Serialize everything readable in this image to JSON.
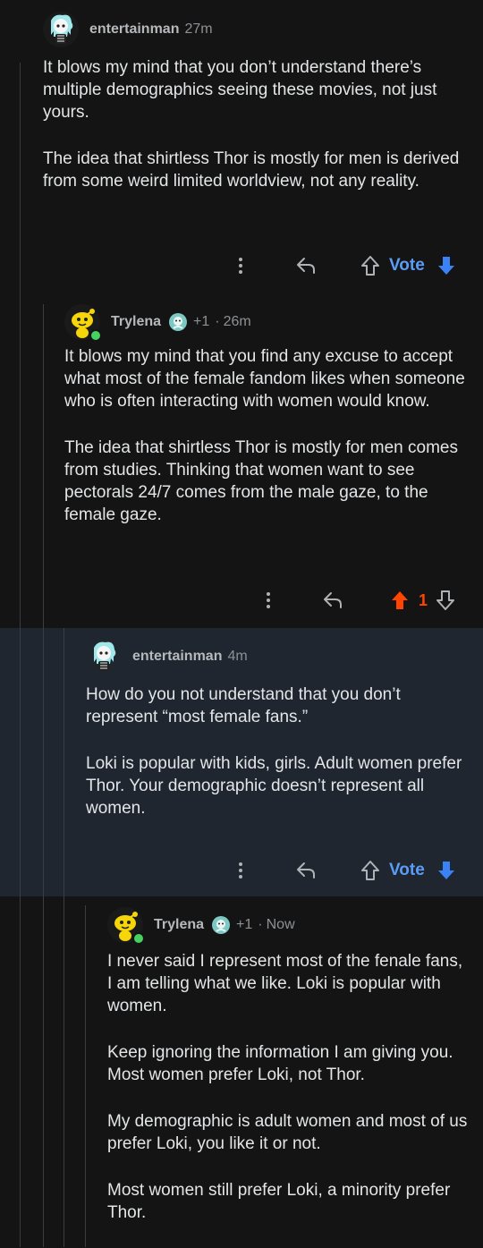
{
  "comments": [
    {
      "username": "entertainman",
      "time": "27m",
      "paragraphs": [
        "It blows my mind that you don’t understand there’s multiple demographics seeing these movies, not just yours.",
        "The idea that shirtless Thor is mostly for men is derived from some weird limited worldview, not any reality."
      ],
      "vote_label": "Vote"
    },
    {
      "username": "Trylena",
      "flair_score": "+1",
      "time": "26m",
      "paragraphs": [
        "It blows my mind that you find any excuse to accept what most of the female fandom likes when someone who is often interacting with women would know.",
        "The idea that shirtless Thor is mostly for men comes from studies. Thinking that women want to see pectorals 24/7 comes from the male gaze, to the female gaze."
      ],
      "score": "1"
    },
    {
      "username": "entertainman",
      "time": "4m",
      "paragraphs": [
        "How do you not understand that you don’t represent “most female fans.”",
        "Loki is popular with kids, girls.  Adult women prefer Thor.  Your demographic doesn’t represent all women."
      ],
      "vote_label": "Vote"
    },
    {
      "username": "Trylena",
      "flair_score": "+1",
      "time": "Now",
      "paragraphs": [
        "I never said I represent most of the fenale fans, I am telling what we like. Loki is popular with women.",
        "Keep ignoring the information I am giving you. Most women prefer Loki, not Thor.",
        "My demographic is adult women and most of us prefer Loki, you like it or not.",
        "Most women still prefer Loki, a minority prefer Thor."
      ]
    }
  ],
  "colors": {
    "background": "#141414",
    "highlight": "#1f2630",
    "upvote_active": "#ff4500",
    "downvote_blue": "#3b82f6",
    "online": "#46d160"
  },
  "icons": [
    "more-options-icon",
    "reply-icon",
    "upvote-icon",
    "downvote-icon",
    "snoo-avatar-icon",
    "flair-icon"
  ]
}
